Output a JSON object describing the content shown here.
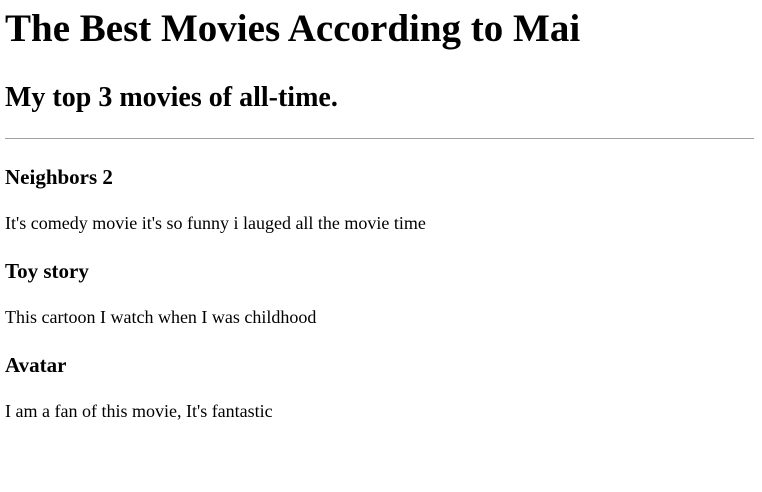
{
  "page": {
    "title": "The Best Movies According to Mai",
    "subtitle": "My top 3 movies of all-time."
  },
  "movies": [
    {
      "title": "Neighbors 2",
      "description": "It's comedy movie it's so funny i lauged all the movie time"
    },
    {
      "title": "Toy story",
      "description": "This cartoon I watch when I was childhood"
    },
    {
      "title": "Avatar",
      "description": "I am a fan of this movie, It's fantastic"
    }
  ]
}
